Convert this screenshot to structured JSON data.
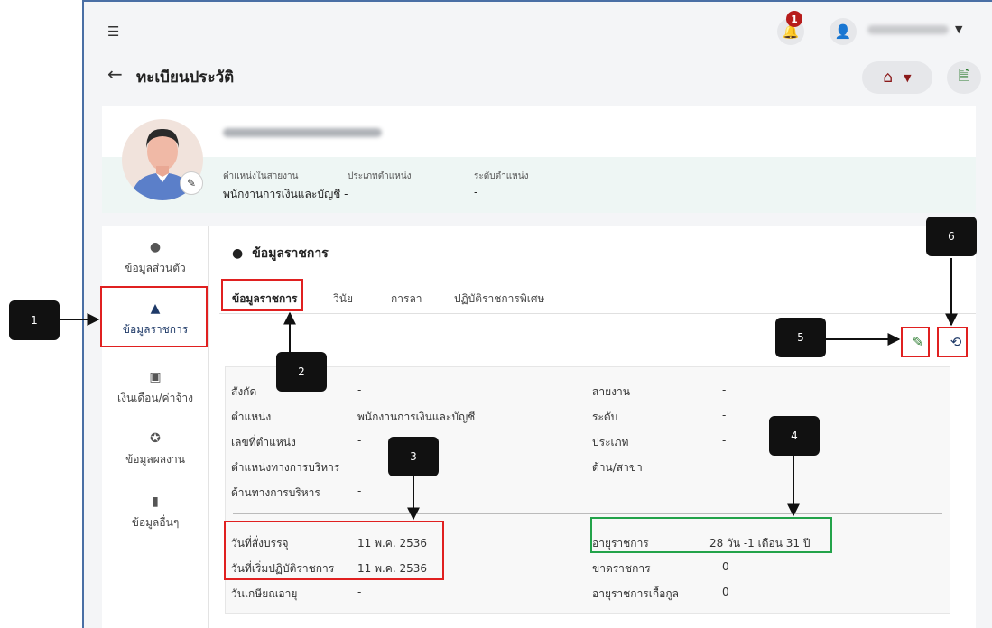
{
  "header": {
    "notification_count": "1",
    "page_title": "ทะเบียนประวัติ"
  },
  "profile": {
    "labels": [
      "ตำแหน่งในสายงาน",
      "ประเภทตำแหน่ง",
      "ระดับตำแหน่ง"
    ],
    "values": [
      "พนักงานการเงินและบัญชี -",
      "",
      "-"
    ]
  },
  "sidebar": {
    "items": [
      {
        "label": "ข้อมูลส่วนตัว",
        "icon": "person-icon"
      },
      {
        "label": "ข้อมูลราชการ",
        "icon": "badge-person-icon"
      },
      {
        "label": "เงินเดือน/ค่าจ้าง",
        "icon": "money-icon"
      },
      {
        "label": "ข้อมูลผลงาน",
        "icon": "medal-icon"
      },
      {
        "label": "ข้อมูลอื่นๆ",
        "icon": "bookmark-icon"
      }
    ]
  },
  "section": {
    "title": "ข้อมูลราชการ",
    "tabs": [
      "ข้อมูลราชการ",
      "วินัย",
      "การลา",
      "ปฏิบัติราชการพิเศษ"
    ]
  },
  "details": {
    "left": [
      {
        "label": "สังกัด",
        "value": "-"
      },
      {
        "label": "ตำแหน่ง",
        "value": "พนักงานการเงินและบัญชี"
      },
      {
        "label": "เลขที่ตำแหน่ง",
        "value": "-"
      },
      {
        "label": "ตำแหน่งทางการบริหาร",
        "value": "-"
      },
      {
        "label": "ด้านทางการบริหาร",
        "value": "-"
      }
    ],
    "right": [
      {
        "label": "สายงาน",
        "value": "-"
      },
      {
        "label": "ระดับ",
        "value": "-"
      },
      {
        "label": "ประเภท",
        "value": "-"
      },
      {
        "label": "ด้าน/สาขา",
        "value": "-"
      }
    ],
    "dates_left": [
      {
        "label": "วันที่สั่งบรรจุ",
        "value": "11 พ.ค. 2536"
      },
      {
        "label": "วันที่เริ่มปฏิบัติราชการ",
        "value": "11 พ.ค. 2536"
      },
      {
        "label": "วันเกษียณอายุ",
        "value": "-"
      }
    ],
    "dates_right": [
      {
        "label": "อายุราชการ",
        "value": "28 วัน -1 เดือน 31 ปี"
      },
      {
        "label": "ขาดราชการ",
        "value": "0"
      },
      {
        "label": "อายุราชการเกื้อกูล",
        "value": "0"
      }
    ]
  },
  "callouts": [
    "1",
    "2",
    "3",
    "4",
    "5",
    "6"
  ],
  "colors": {
    "accent_red": "#e02020",
    "accent_green": "#23a34a",
    "primary_navy": "#1f3a68",
    "home_icon": "#8b1a1a",
    "doc_icon": "#2e7d32"
  }
}
